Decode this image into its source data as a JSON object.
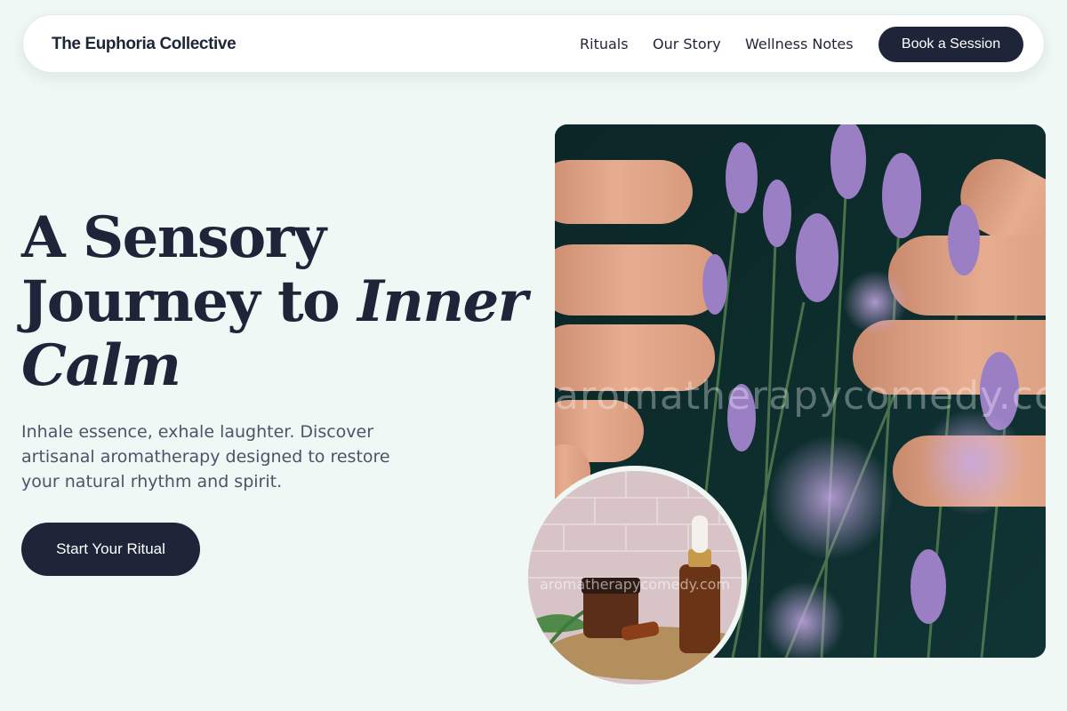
{
  "nav": {
    "brand": "The Euphoria Collective",
    "links": [
      "Rituals",
      "Our Story",
      "Wellness Notes"
    ],
    "book_label": "Book a Session"
  },
  "hero": {
    "headline_line1": "A Sensory",
    "headline_line2a": "Journey to ",
    "headline_line2b": "Inner",
    "headline_line3": "Calm",
    "copy": "Inhale essence, exhale laughter. Discover artisanal aromatherapy designed to restore your natural rhythm and spirit.",
    "cta_label": "Start Your Ritual"
  },
  "images": {
    "main_watermark": "aromatherapycomedy.com",
    "inset_watermark": "aromatherapycomedy.com"
  },
  "colors": {
    "background": "#eff8f5",
    "primary_dark": "#1e2538",
    "text_muted": "#4a5568",
    "lavender": "#9b7fc4"
  }
}
